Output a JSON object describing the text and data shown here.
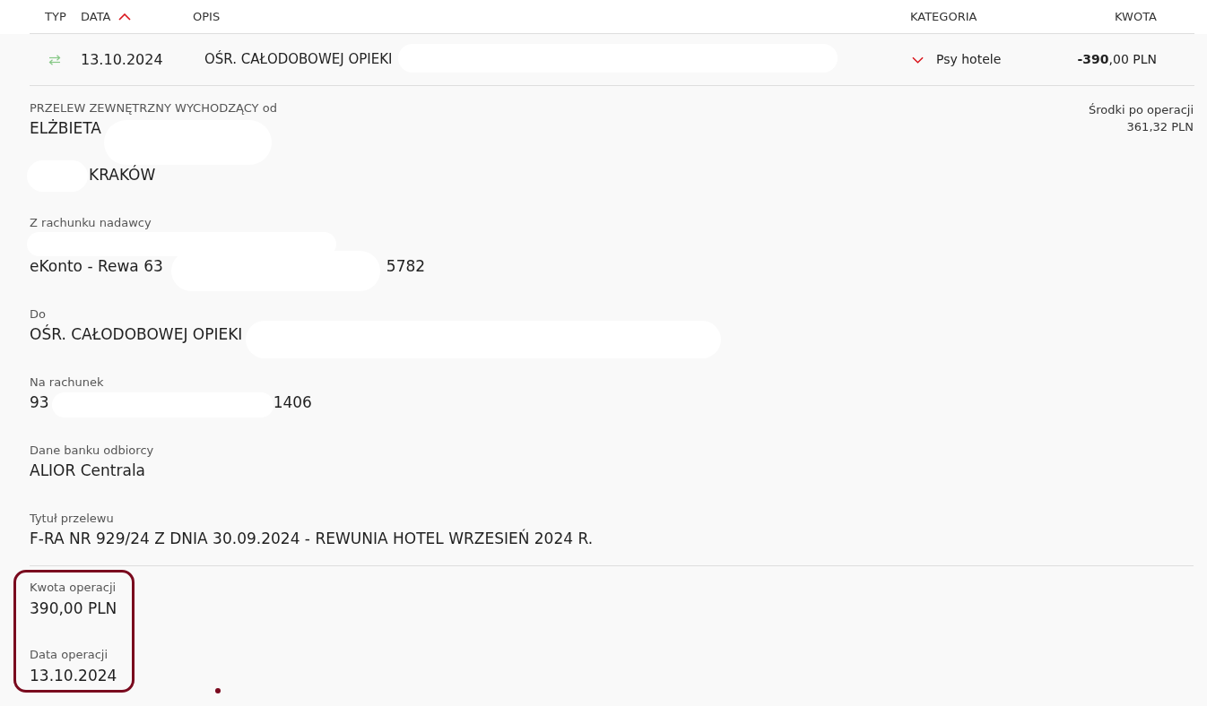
{
  "table": {
    "columns": [
      {
        "label": "TYP",
        "sorted": false
      },
      {
        "label": "DATA",
        "sorted": true
      },
      {
        "label": "OPIS",
        "sorted": false
      },
      {
        "label": "KATEGORIA",
        "sorted": false
      },
      {
        "label": "KWOTA",
        "sorted": false
      }
    ],
    "rows": [
      {
        "date": "13.10.2024",
        "description": [
          {
            "kind": "text",
            "text": "OŚR. CAŁODOBOWEJ OPIEKI"
          },
          {
            "kind": "redaction"
          }
        ],
        "category": "Psy hotele",
        "amount": "**-390**,00 PLN",
        "details": {
          "sections": [
            {
              "label": "PRZELEW ZEWNĘTRZNY WYCHODZĄCY od",
              "lines": [
                [
                  {
                    "kind": "text",
                    "text": "ELŻBIETA"
                  },
                  {
                    "kind": "redaction"
                  }
                ],
                [
                  {
                    "kind": "redaction"
                  },
                  {
                    "kind": "text",
                    "text": "KRAKÓW"
                  }
                ]
              ]
            },
            {
              "label": "Z rachunku nadawcy",
              "lines": [
                [
                  {
                    "kind": "redaction"
                  }
                ],
                [
                  {
                    "kind": "text",
                    "text": "eKonto - Rewa 63"
                  },
                  {
                    "kind": "redaction"
                  },
                  {
                    "kind": "text",
                    "text": "5782"
                  }
                ]
              ]
            },
            {
              "label": "Do",
              "lines": [
                [
                  {
                    "kind": "text",
                    "text": "OŚR. CAŁODOBOWEJ OPIEKI"
                  },
                  {
                    "kind": "redaction"
                  }
                ]
              ]
            },
            {
              "label": "Na rachunek",
              "lines": [
                [
                  {
                    "kind": "text",
                    "text": "93"
                  },
                  {
                    "kind": "redaction"
                  },
                  {
                    "kind": "text",
                    "text": "1406"
                  }
                ]
              ]
            },
            {
              "label": "Dane banku odbiorcy",
              "lines": [
                [
                  {
                    "kind": "text",
                    "text": "ALIOR Centrala"
                  }
                ]
              ]
            },
            {
              "label": "Tytuł przelewu",
              "lines": [
                [
                  {
                    "kind": "text",
                    "text": "F-RA NR 929/24 Z DNIA 30.09.2024 - REWUNIA HOTEL WRZESIEŃ 2024 R."
                  }
                ]
              ]
            }
          ],
          "balance": {
            "label": "Środki po operacji",
            "value": "361,32 PLN"
          },
          "summary": {
            "highlighted": true,
            "fields": [
              {
                "label": "Kwota operacji",
                "value": "390,00 PLN"
              },
              {
                "label": "Data operacji",
                "value": "13.10.2024"
              }
            ]
          },
          "marker_dot": true
        }
      }
    ]
  }
}
